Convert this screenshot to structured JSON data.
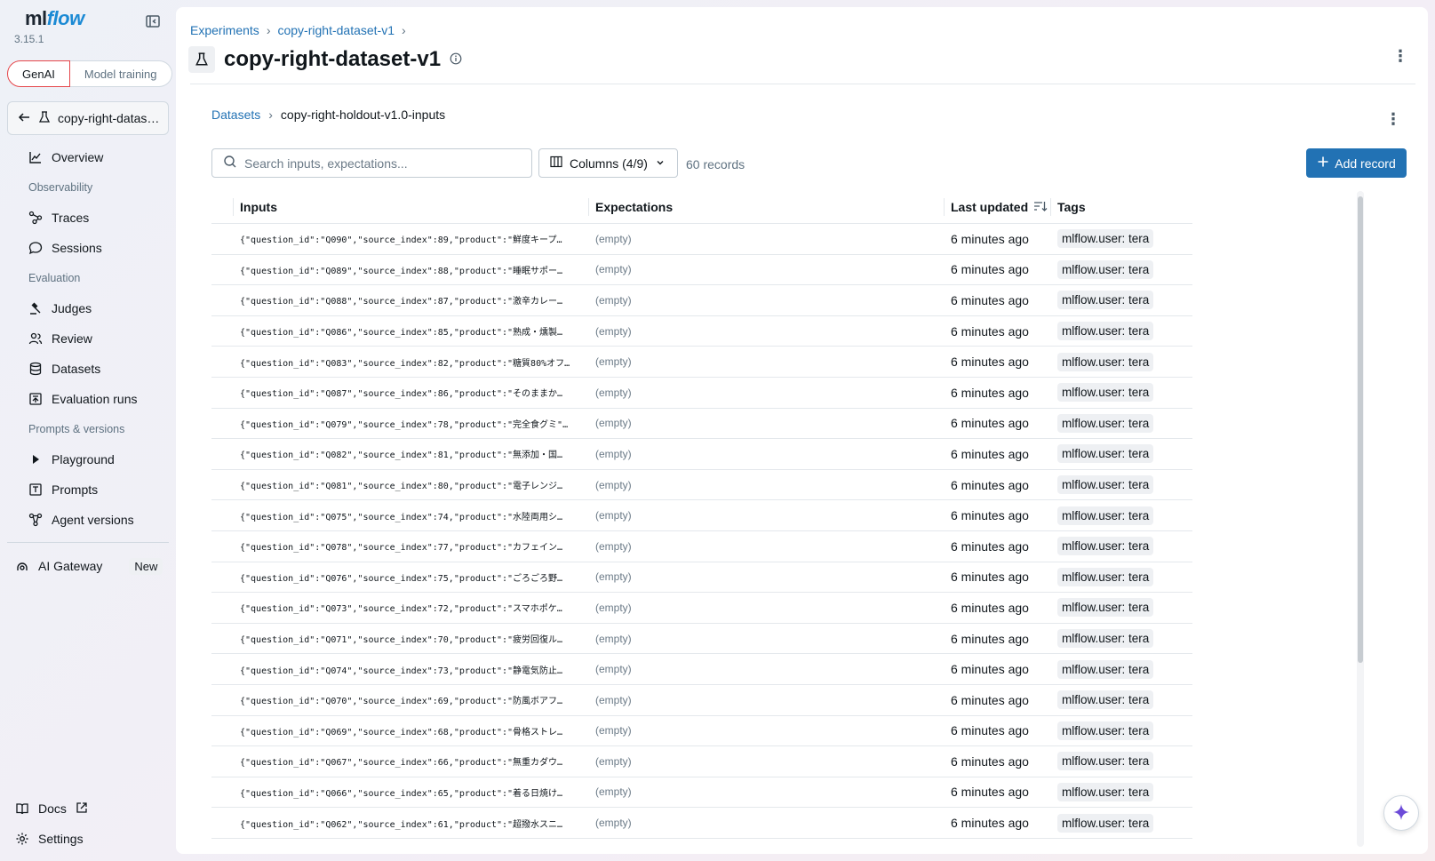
{
  "app": {
    "logo_ml": "ml",
    "logo_flow": "flow",
    "version": "3.15.1"
  },
  "modes": {
    "genai": "GenAI",
    "model_training": "Model training"
  },
  "experiment_selector": {
    "name": "copy-right-dataset-v1",
    "display": "copy-right-datas…"
  },
  "nav": {
    "overview": "Overview",
    "observability": "Observability",
    "traces": "Traces",
    "sessions": "Sessions",
    "evaluation": "Evaluation",
    "judges": "Judges",
    "review": "Review",
    "datasets": "Datasets",
    "evaluation_runs": "Evaluation runs",
    "prompts_versions": "Prompts & versions",
    "playground": "Playground",
    "prompts": "Prompts",
    "agent_versions": "Agent versions",
    "ai_gateway": "AI Gateway",
    "new_badge": "New",
    "docs": "Docs",
    "settings": "Settings"
  },
  "header": {
    "breadcrumb_experiments": "Experiments",
    "breadcrumb_experiment": "copy-right-dataset-v1",
    "title": "copy-right-dataset-v1"
  },
  "dataset": {
    "breadcrumb_datasets": "Datasets",
    "breadcrumb_current": "copy-right-holdout-v1.0-inputs",
    "search_placeholder": "Search inputs, expectations...",
    "columns_label": "Columns (4/9)",
    "records_count": "60 records",
    "add_record": "Add record"
  },
  "table": {
    "headers": {
      "inputs": "Inputs",
      "expectations": "Expectations",
      "last_updated": "Last updated",
      "tags": "Tags"
    },
    "rows": [
      {
        "inputs": "{\"question_id\":\"Q090\",\"source_index\":89,\"product\":\"鮮度キープ…",
        "expectations": "(empty)",
        "last_updated": "6 minutes ago",
        "tag": "mlflow.user: tera"
      },
      {
        "inputs": "{\"question_id\":\"Q089\",\"source_index\":88,\"product\":\"睡眠サポー…",
        "expectations": "(empty)",
        "last_updated": "6 minutes ago",
        "tag": "mlflow.user: tera"
      },
      {
        "inputs": "{\"question_id\":\"Q088\",\"source_index\":87,\"product\":\"激辛カレー…",
        "expectations": "(empty)",
        "last_updated": "6 minutes ago",
        "tag": "mlflow.user: tera"
      },
      {
        "inputs": "{\"question_id\":\"Q086\",\"source_index\":85,\"product\":\"熟成・燻製…",
        "expectations": "(empty)",
        "last_updated": "6 minutes ago",
        "tag": "mlflow.user: tera"
      },
      {
        "inputs": "{\"question_id\":\"Q083\",\"source_index\":82,\"product\":\"糖質80%オフ…",
        "expectations": "(empty)",
        "last_updated": "6 minutes ago",
        "tag": "mlflow.user: tera"
      },
      {
        "inputs": "{\"question_id\":\"Q087\",\"source_index\":86,\"product\":\"そのままか…",
        "expectations": "(empty)",
        "last_updated": "6 minutes ago",
        "tag": "mlflow.user: tera"
      },
      {
        "inputs": "{\"question_id\":\"Q079\",\"source_index\":78,\"product\":\"完全食グミ\"…",
        "expectations": "(empty)",
        "last_updated": "6 minutes ago",
        "tag": "mlflow.user: tera"
      },
      {
        "inputs": "{\"question_id\":\"Q082\",\"source_index\":81,\"product\":\"無添加・国…",
        "expectations": "(empty)",
        "last_updated": "6 minutes ago",
        "tag": "mlflow.user: tera"
      },
      {
        "inputs": "{\"question_id\":\"Q081\",\"source_index\":80,\"product\":\"電子レンジ…",
        "expectations": "(empty)",
        "last_updated": "6 minutes ago",
        "tag": "mlflow.user: tera"
      },
      {
        "inputs": "{\"question_id\":\"Q075\",\"source_index\":74,\"product\":\"水陸両用シ…",
        "expectations": "(empty)",
        "last_updated": "6 minutes ago",
        "tag": "mlflow.user: tera"
      },
      {
        "inputs": "{\"question_id\":\"Q078\",\"source_index\":77,\"product\":\"カフェイン…",
        "expectations": "(empty)",
        "last_updated": "6 minutes ago",
        "tag": "mlflow.user: tera"
      },
      {
        "inputs": "{\"question_id\":\"Q076\",\"source_index\":75,\"product\":\"ごろごろ野…",
        "expectations": "(empty)",
        "last_updated": "6 minutes ago",
        "tag": "mlflow.user: tera"
      },
      {
        "inputs": "{\"question_id\":\"Q073\",\"source_index\":72,\"product\":\"スマホポケ…",
        "expectations": "(empty)",
        "last_updated": "6 minutes ago",
        "tag": "mlflow.user: tera"
      },
      {
        "inputs": "{\"question_id\":\"Q071\",\"source_index\":70,\"product\":\"疲労回復ル…",
        "expectations": "(empty)",
        "last_updated": "6 minutes ago",
        "tag": "mlflow.user: tera"
      },
      {
        "inputs": "{\"question_id\":\"Q074\",\"source_index\":73,\"product\":\"静電気防止…",
        "expectations": "(empty)",
        "last_updated": "6 minutes ago",
        "tag": "mlflow.user: tera"
      },
      {
        "inputs": "{\"question_id\":\"Q070\",\"source_index\":69,\"product\":\"防風ボアフ…",
        "expectations": "(empty)",
        "last_updated": "6 minutes ago",
        "tag": "mlflow.user: tera"
      },
      {
        "inputs": "{\"question_id\":\"Q069\",\"source_index\":68,\"product\":\"骨格ストレ…",
        "expectations": "(empty)",
        "last_updated": "6 minutes ago",
        "tag": "mlflow.user: tera"
      },
      {
        "inputs": "{\"question_id\":\"Q067\",\"source_index\":66,\"product\":\"無重カダウ…",
        "expectations": "(empty)",
        "last_updated": "6 minutes ago",
        "tag": "mlflow.user: tera"
      },
      {
        "inputs": "{\"question_id\":\"Q066\",\"source_index\":65,\"product\":\"着る日焼け…",
        "expectations": "(empty)",
        "last_updated": "6 minutes ago",
        "tag": "mlflow.user: tera"
      },
      {
        "inputs": "{\"question_id\":\"Q062\",\"source_index\":61,\"product\":\"超撥水スニ…",
        "expectations": "(empty)",
        "last_updated": "6 minutes ago",
        "tag": "mlflow.user: tera"
      }
    ]
  },
  "colors": {
    "accent": "#2272b4",
    "genai_border": "#e5464a",
    "logo_flow": "#1b8ad4"
  }
}
